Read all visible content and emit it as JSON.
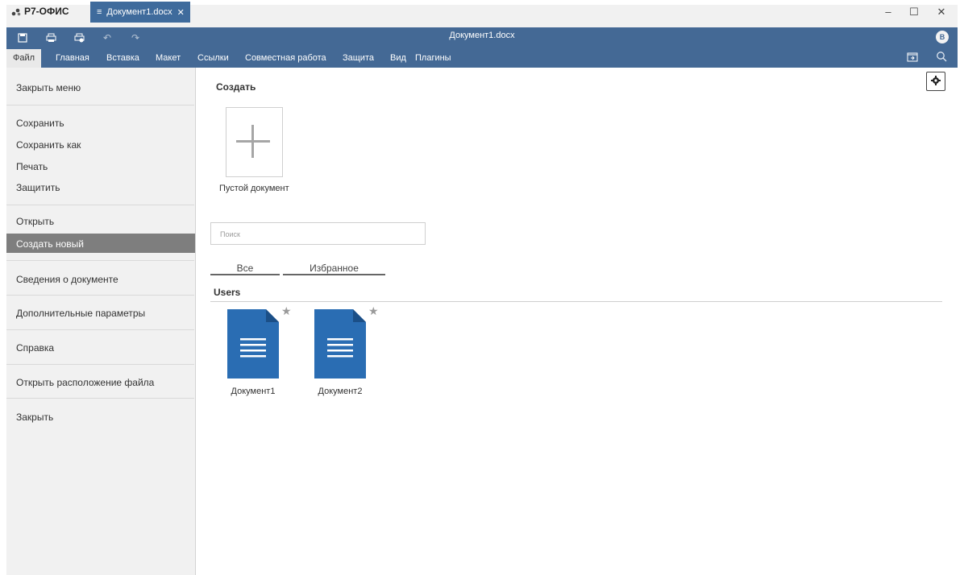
{
  "app": {
    "brand": "Р7-ОФИС",
    "tab_title": "Документ1.docx",
    "doc_title": "Документ1.docx",
    "avatar_initial": "В"
  },
  "menu": {
    "items": [
      "Файл",
      "Главная",
      "Вставка",
      "Макет",
      "Ссылки",
      "Совместная работа",
      "Защита",
      "Вид",
      "Плагины"
    ]
  },
  "left_menu": {
    "close_menu": "Закрыть меню",
    "save": "Сохранить",
    "save_as": "Сохранить как",
    "print": "Печать",
    "protect": "Защитить",
    "open": "Открыть",
    "create_new": "Создать новый",
    "doc_info": "Сведения о документе",
    "advanced": "Дополнительные параметры",
    "help": "Справка",
    "open_location": "Открыть расположение файла",
    "close": "Закрыть"
  },
  "main": {
    "create_title": "Создать",
    "blank_doc_label": "Пустой документ",
    "search_placeholder": "Поиск",
    "tab_all": "Все",
    "tab_favorites": "Избранное",
    "users_section": "Users",
    "files": [
      {
        "name": "Документ1"
      },
      {
        "name": "Документ2"
      }
    ]
  },
  "colors": {
    "header_blue": "#446995",
    "doc_icon_blue": "#2a6db3",
    "active_item": "#7e7e7e"
  }
}
